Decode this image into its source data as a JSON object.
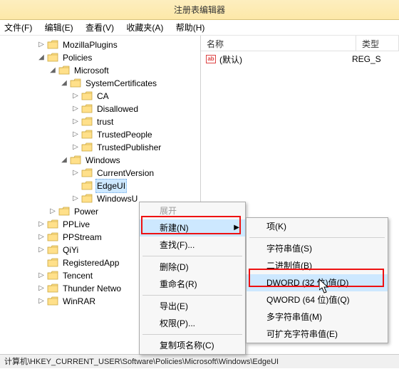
{
  "title": "注册表编辑器",
  "menu": {
    "file": "文件(F)",
    "edit": "编辑(E)",
    "view": "查看(V)",
    "favorites": "收藏夹(A)",
    "help": "帮助(H)"
  },
  "tree": {
    "mozilla": "MozillaPlugins",
    "policies": "Policies",
    "microsoft": "Microsoft",
    "syscert": "SystemCertificates",
    "ca": "CA",
    "disallowed": "Disallowed",
    "trust": "trust",
    "trustedpeople": "TrustedPeople",
    "trustedpub": "TrustedPublisher",
    "windows_p": "Windows",
    "currentversion": "CurrentVersion",
    "edgeui": "EdgeUI",
    "windowsu": "WindowsU",
    "power": "Power",
    "pplive": "PPLive",
    "ppstream": "PPStream",
    "qiyi": "QiYi",
    "regapp": "RegisteredApp",
    "tencent": "Tencent",
    "thunder": "Thunder Netwo",
    "winrar": "WinRAR"
  },
  "list": {
    "col_name": "名称",
    "col_type": "类型",
    "default_name": "(默认)",
    "default_type": "REG_S"
  },
  "ctx1": {
    "expand": "展开",
    "new": "新建(N)",
    "find": "查找(F)...",
    "delete": "删除(D)",
    "rename": "重命名(R)",
    "export": "导出(E)",
    "perm": "权限(P)...",
    "copyname": "复制项名称(C)"
  },
  "ctx2": {
    "key": "项(K)",
    "string": "字符串值(S)",
    "binary": "二进制值(B)",
    "dword": "DWORD (32 位)值(D)",
    "qword": "QWORD (64 位)值(Q)",
    "multi": "多字符串值(M)",
    "expand": "可扩充字符串值(E)"
  },
  "status": "计算机\\HKEY_CURRENT_USER\\Software\\Policies\\Microsoft\\Windows\\EdgeUI"
}
